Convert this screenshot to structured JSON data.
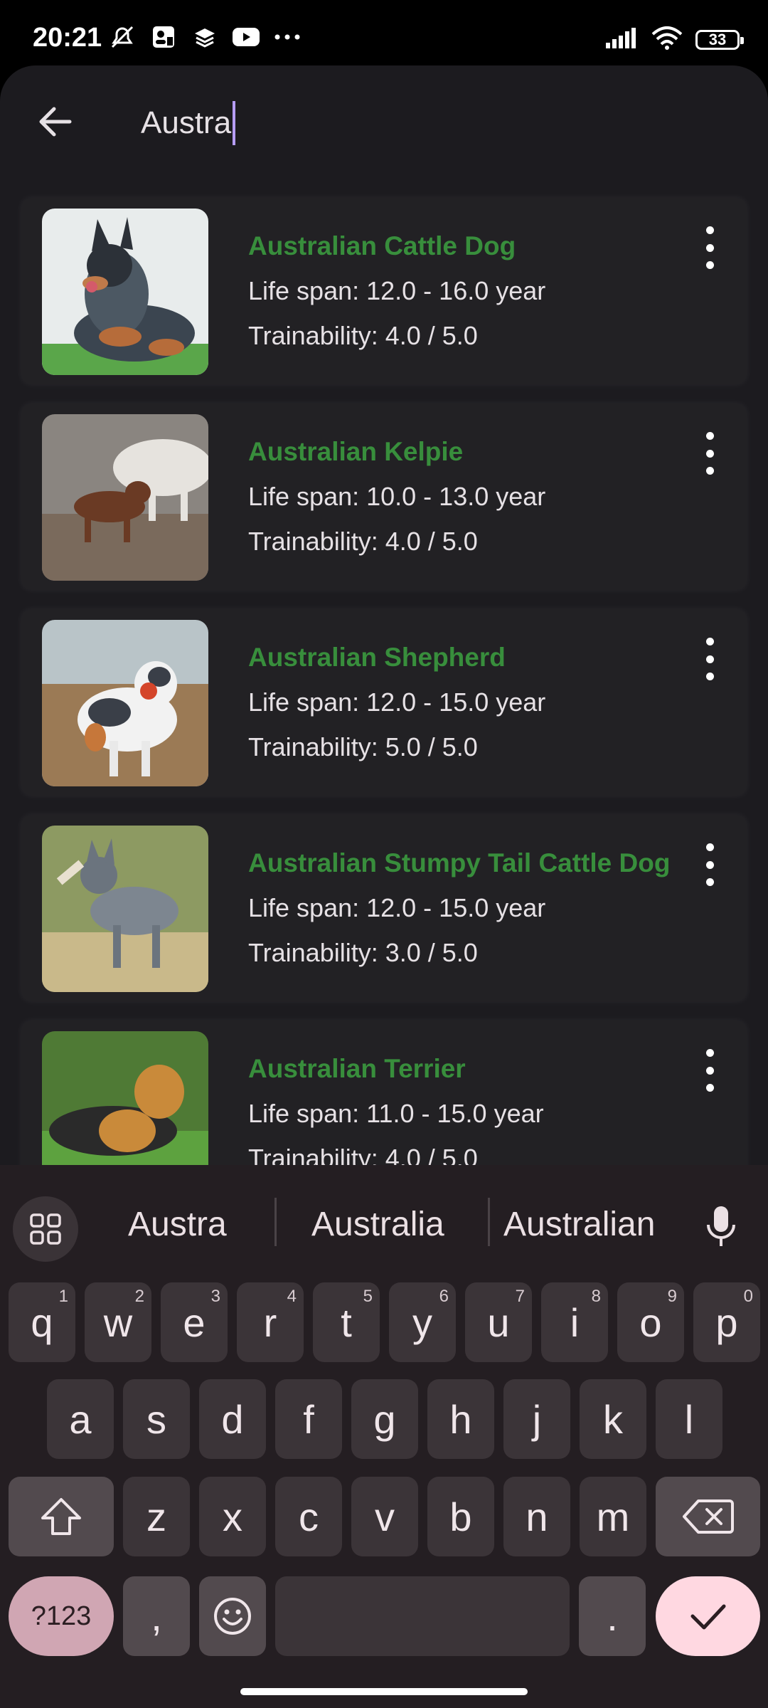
{
  "status_bar": {
    "time": "20:21",
    "battery": "33"
  },
  "search": {
    "query": "Austra"
  },
  "breeds": [
    {
      "name": "Australian Cattle Dog",
      "life_span": "Life span: 12.0 - 16.0 year",
      "trainability": "Trainability: 4.0 / 5.0"
    },
    {
      "name": "Australian Kelpie",
      "life_span": "Life span: 10.0 - 13.0 year",
      "trainability": "Trainability: 4.0 / 5.0"
    },
    {
      "name": "Australian Shepherd",
      "life_span": "Life span: 12.0 - 15.0 year",
      "trainability": "Trainability: 5.0 / 5.0"
    },
    {
      "name": "Australian Stumpy Tail Cattle Dog",
      "life_span": "Life span: 12.0 - 15.0 year",
      "trainability": "Trainability: 3.0 / 5.0"
    },
    {
      "name": "Australian Terrier",
      "life_span": "Life span: 11.0 - 15.0 year",
      "trainability": "Trainability: 4.0 / 5.0"
    }
  ],
  "keyboard": {
    "suggestions": [
      "Austra",
      "Australia",
      "Australian"
    ],
    "row1": [
      {
        "k": "q",
        "n": "1"
      },
      {
        "k": "w",
        "n": "2"
      },
      {
        "k": "e",
        "n": "3"
      },
      {
        "k": "r",
        "n": "4"
      },
      {
        "k": "t",
        "n": "5"
      },
      {
        "k": "y",
        "n": "6"
      },
      {
        "k": "u",
        "n": "7"
      },
      {
        "k": "i",
        "n": "8"
      },
      {
        "k": "o",
        "n": "9"
      },
      {
        "k": "p",
        "n": "0"
      }
    ],
    "row2": [
      "a",
      "s",
      "d",
      "f",
      "g",
      "h",
      "j",
      "k",
      "l"
    ],
    "row3": [
      "z",
      "x",
      "c",
      "v",
      "b",
      "n",
      "m"
    ],
    "symbols_label": "?123",
    "comma": ",",
    "period": "."
  }
}
